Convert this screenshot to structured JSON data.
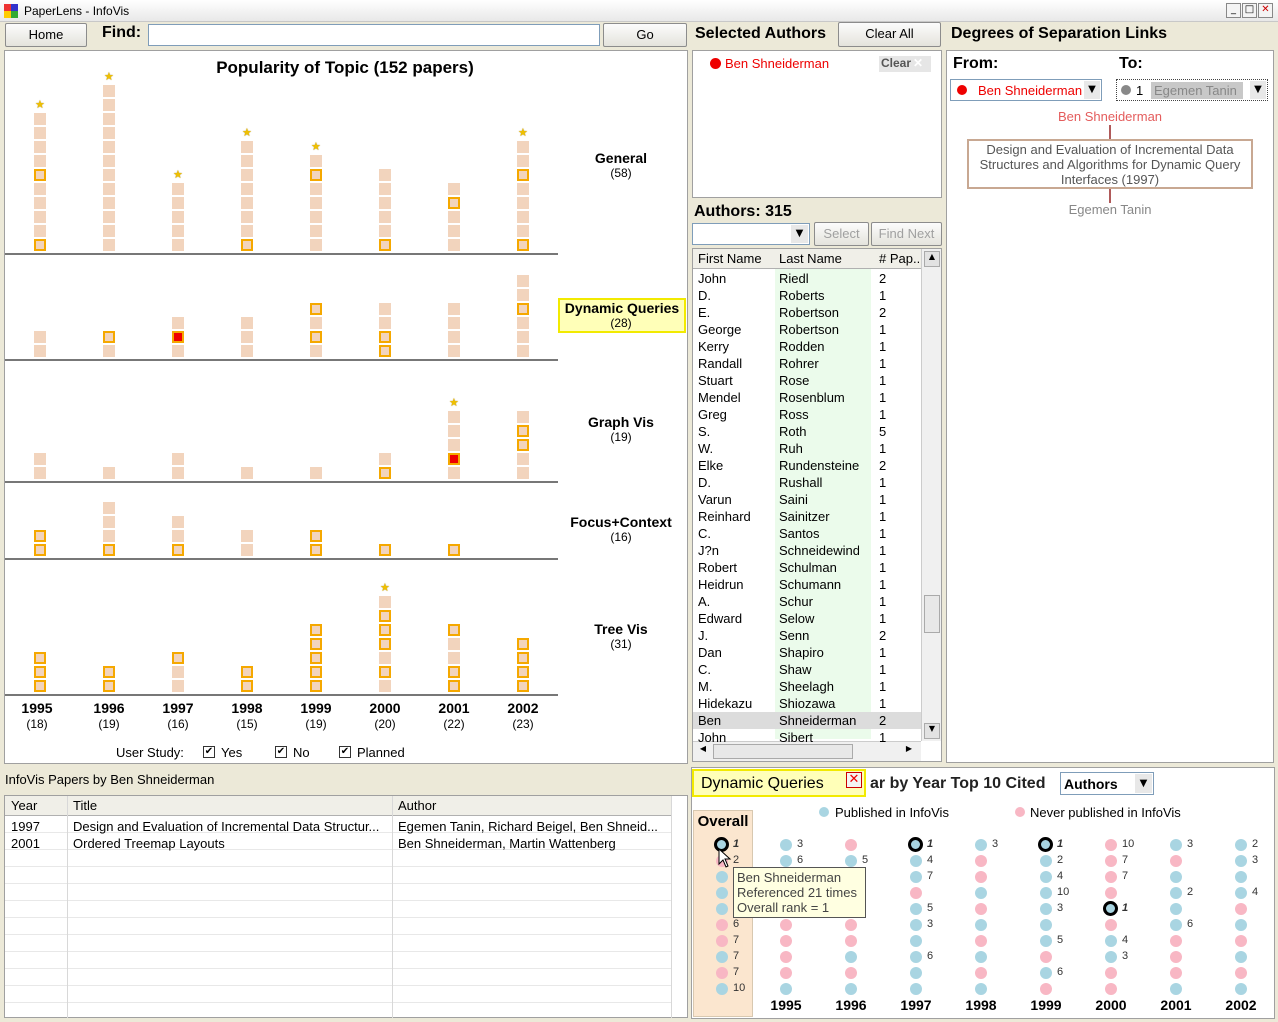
{
  "window": {
    "title": "PaperLens - InfoVis",
    "min": "_",
    "max": "□",
    "close": "✕"
  },
  "toolbar": {
    "home": "Home",
    "find_label": "Find:",
    "find_value": "",
    "go": "Go"
  },
  "popularity": {
    "title": "Popularity of Topic (152 papers)",
    "topics": [
      {
        "name": "General",
        "count": "(58)"
      },
      {
        "name": "Dynamic Queries",
        "count": "(28)"
      },
      {
        "name": "Graph Vis",
        "count": "(19)"
      },
      {
        "name": "Focus+Context",
        "count": "(16)"
      },
      {
        "name": "Tree Vis",
        "count": "(31)"
      }
    ],
    "years": [
      {
        "year": "1995",
        "count": "(18)"
      },
      {
        "year": "1996",
        "count": "(19)"
      },
      {
        "year": "1997",
        "count": "(16)"
      },
      {
        "year": "1998",
        "count": "(15)"
      },
      {
        "year": "1999",
        "count": "(19)"
      },
      {
        "year": "2000",
        "count": "(20)"
      },
      {
        "year": "2001",
        "count": "(22)"
      },
      {
        "year": "2002",
        "count": "(23)"
      }
    ],
    "user_study_label": "User Study:",
    "user_study_options": [
      "Yes",
      "No",
      "Planned"
    ],
    "stacks": [
      [
        {
          "n": 10,
          "hl": [
            1,
            6
          ],
          "star": true
        },
        {
          "n": 12,
          "hl": [],
          "star": true
        },
        {
          "n": 5,
          "hl": [],
          "star": true
        },
        {
          "n": 8,
          "hl": [
            1
          ],
          "star": true
        },
        {
          "n": 7,
          "hl": [
            6
          ],
          "star": true
        },
        {
          "n": 6,
          "hl": [
            1
          ],
          "star": false
        },
        {
          "n": 5,
          "hl": [
            4
          ],
          "star": false
        },
        {
          "n": 8,
          "hl": [
            1,
            6
          ],
          "star": true
        }
      ],
      [
        {
          "n": 2,
          "hl": [],
          "star": false
        },
        {
          "n": 2,
          "hl": [
            2
          ],
          "star": false
        },
        {
          "n": 3,
          "hl": [
            2
          ],
          "sel": [
            2
          ],
          "star": false
        },
        {
          "n": 3,
          "hl": [],
          "star": false
        },
        {
          "n": 4,
          "hl": [
            2,
            4
          ],
          "star": false
        },
        {
          "n": 4,
          "hl": [
            1,
            2
          ],
          "star": false
        },
        {
          "n": 4,
          "hl": [],
          "star": false
        },
        {
          "n": 6,
          "hl": [
            4
          ],
          "star": false
        }
      ],
      [
        {
          "n": 2,
          "hl": [],
          "star": false
        },
        {
          "n": 1,
          "hl": [],
          "star": false
        },
        {
          "n": 2,
          "hl": [],
          "star": false
        },
        {
          "n": 1,
          "hl": [],
          "star": false
        },
        {
          "n": 1,
          "hl": [],
          "star": false
        },
        {
          "n": 2,
          "hl": [
            1
          ],
          "star": false
        },
        {
          "n": 5,
          "hl": [],
          "sel": [
            2
          ],
          "star": true
        },
        {
          "n": 5,
          "hl": [
            3,
            4
          ],
          "star": false
        }
      ],
      [
        {
          "n": 2,
          "hl": [
            1,
            2
          ],
          "star": false
        },
        {
          "n": 4,
          "hl": [
            1
          ],
          "star": false
        },
        {
          "n": 3,
          "hl": [
            1
          ],
          "star": false
        },
        {
          "n": 2,
          "hl": [],
          "star": false
        },
        {
          "n": 2,
          "hl": [
            1,
            2
          ],
          "star": false
        },
        {
          "n": 1,
          "hl": [
            1
          ],
          "star": false
        },
        {
          "n": 1,
          "hl": [
            1
          ],
          "star": false
        },
        {
          "n": 0,
          "hl": [],
          "star": false
        }
      ],
      [
        {
          "n": 3,
          "hl": [
            1,
            2,
            3
          ],
          "star": false
        },
        {
          "n": 2,
          "hl": [
            1,
            2
          ],
          "star": false
        },
        {
          "n": 3,
          "hl": [
            3
          ],
          "star": false
        },
        {
          "n": 2,
          "hl": [
            1,
            2
          ],
          "star": false
        },
        {
          "n": 5,
          "hl": [
            1,
            2,
            3,
            4,
            5
          ],
          "star": false
        },
        {
          "n": 7,
          "hl": [
            2,
            4,
            5,
            6
          ],
          "star": true
        },
        {
          "n": 5,
          "hl": [
            1,
            2,
            5
          ],
          "star": false
        },
        {
          "n": 4,
          "hl": [
            1,
            2,
            3,
            4
          ],
          "star": false
        }
      ]
    ]
  },
  "selected_authors": {
    "title": "Selected Authors",
    "clear_all": "Clear All",
    "items": [
      {
        "name": "Ben Shneiderman",
        "clear": "Clear"
      }
    ]
  },
  "authors": {
    "title": "Authors: 315",
    "select": "Select",
    "find_next": "Find Next",
    "columns": [
      "First Name",
      "Last Name",
      "# Pap.."
    ],
    "rows": [
      [
        "John",
        "Riedl",
        "2"
      ],
      [
        "D.",
        "Roberts",
        "1"
      ],
      [
        "E.",
        "Robertson",
        "2"
      ],
      [
        "George",
        "Robertson",
        "1"
      ],
      [
        "Kerry",
        "Rodden",
        "1"
      ],
      [
        "Randall",
        "Rohrer",
        "1"
      ],
      [
        "Stuart",
        "Rose",
        "1"
      ],
      [
        "Mendel",
        "Rosenblum",
        "1"
      ],
      [
        "Greg",
        "Ross",
        "1"
      ],
      [
        "S.",
        "Roth",
        "5"
      ],
      [
        "W.",
        "Ruh",
        "1"
      ],
      [
        "Elke",
        "Rundensteiner",
        "2"
      ],
      [
        "D.",
        "Rushall",
        "1"
      ],
      [
        "Varun",
        "Saini",
        "1"
      ],
      [
        "Reinhard",
        "Sainitzer",
        "1"
      ],
      [
        "C.",
        "Santos",
        "1"
      ],
      [
        "J?n",
        "Schneidewind",
        "1"
      ],
      [
        "Robert",
        "Schulman",
        "1"
      ],
      [
        "Heidrun",
        "Schumann",
        "1"
      ],
      [
        "A.",
        "Schur",
        "1"
      ],
      [
        "Edward",
        "Selow",
        "1"
      ],
      [
        "J.",
        "Senn",
        "2"
      ],
      [
        "Dan",
        "Shapiro",
        "1"
      ],
      [
        "C.",
        "Shaw",
        "1"
      ],
      [
        "M.",
        "Sheelagh",
        "1"
      ],
      [
        "Hidekazu",
        "Shiozawa",
        "1"
      ],
      [
        "Ben",
        "Shneiderman",
        "2"
      ],
      [
        "John",
        "Sibert",
        "1"
      ]
    ],
    "selected_row": 26
  },
  "degrees": {
    "title": "Degrees of Separation Links",
    "from_label": "From:",
    "to_label": "To:",
    "from_value": "Ben Shneiderman",
    "to_count": "1",
    "to_value": "Egemen Tanin",
    "node_from": "Ben Shneiderman",
    "paper": "Design and Evaluation of Incremental Data Structures and Algorithms for Dynamic Query Interfaces (1997)",
    "node_to": "Egemen Tanin"
  },
  "papers": {
    "title": "InfoVis Papers by Ben Shneiderman",
    "columns": [
      "Year",
      "Title",
      "Author"
    ],
    "rows": [
      [
        "1997",
        "Design and Evaluation of Incremental Data Structur...",
        "Egemen Tanin, Richard Beigel, Ben Shneid..."
      ],
      [
        "2001",
        "Ordered Treemap Layouts",
        "Ben Shneiderman, Martin Wattenberg"
      ]
    ]
  },
  "cited": {
    "topic_tag": "Dynamic Queries",
    "title_rest": "ar by Year Top 10 Cited",
    "dropdown": "Authors",
    "legend_published": "Published in InfoVis",
    "legend_never": "Never published in InfoVis",
    "overall": "Overall",
    "years": [
      "1995",
      "1996",
      "1997",
      "1998",
      "1999",
      "2000",
      "2001",
      "2002"
    ],
    "tooltip": [
      "Ben Shneiderman",
      "Referenced 21 times",
      "Overall rank = 1"
    ],
    "overall_labels": [
      "1",
      "2",
      "",
      "",
      "",
      "6",
      "7",
      "7",
      "7",
      "10"
    ],
    "columns": [
      {
        "c": [
          "b",
          "b",
          "b",
          "b",
          "b",
          "p",
          "p",
          "p",
          "p",
          "b"
        ],
        "l": [
          "3",
          "6",
          "",
          "",
          "",
          "",
          "",
          "",
          "",
          ""
        ]
      },
      {
        "c": [
          "p",
          "b",
          "p",
          "b",
          "p",
          "p",
          "p",
          "b",
          "p",
          "b"
        ],
        "l": [
          "",
          "5",
          "",
          "",
          "",
          "",
          "",
          "",
          "",
          ""
        ]
      },
      {
        "c": [
          "b",
          "b",
          "b",
          "p",
          "b",
          "b",
          "b",
          "b",
          "b",
          "b"
        ],
        "l": [
          "1",
          "4",
          "7",
          "",
          "5",
          "3",
          "",
          "6",
          "",
          ""
        ]
      },
      {
        "c": [
          "b",
          "p",
          "p",
          "b",
          "p",
          "b",
          "p",
          "b",
          "p",
          "b"
        ],
        "l": [
          "3",
          "",
          "",
          "",
          "",
          "",
          "",
          "",
          "",
          ""
        ]
      },
      {
        "c": [
          "b",
          "b",
          "b",
          "b",
          "b",
          "b",
          "b",
          "p",
          "b",
          "p"
        ],
        "l": [
          "1",
          "2",
          "4",
          "10",
          "3",
          "",
          "5",
          "",
          "6",
          ""
        ]
      },
      {
        "c": [
          "p",
          "p",
          "p",
          "p",
          "b",
          "p",
          "b",
          "b",
          "p",
          "p"
        ],
        "l": [
          "10",
          "7",
          "7",
          "",
          "1",
          "",
          "4",
          "3",
          "",
          ""
        ]
      },
      {
        "c": [
          "b",
          "p",
          "b",
          "b",
          "b",
          "b",
          "p",
          "p",
          "p",
          "b"
        ],
        "l": [
          "3",
          "",
          "",
          "2",
          "",
          "6",
          "",
          "",
          "",
          ""
        ]
      },
      {
        "c": [
          "b",
          "b",
          "b",
          "b",
          "p",
          "b",
          "p",
          "b",
          "p",
          "b"
        ],
        "l": [
          "2",
          "3",
          "",
          "4",
          "",
          "",
          "",
          "",
          "",
          ""
        ]
      }
    ]
  }
}
